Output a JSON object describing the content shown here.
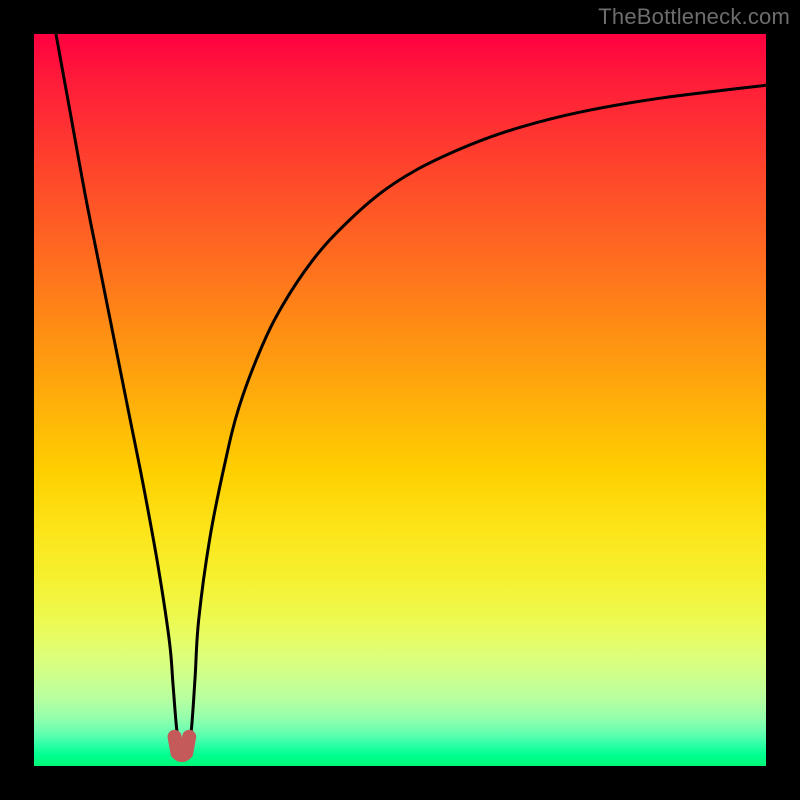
{
  "watermark": "TheBottleneck.com",
  "chart_data": {
    "type": "line",
    "title": "",
    "xlabel": "",
    "ylabel": "",
    "xlim": [
      0,
      100
    ],
    "ylim": [
      0,
      100
    ],
    "grid": false,
    "legend": false,
    "series": [
      {
        "name": "bottleneck-curve",
        "color": "#000000",
        "x": [
          3,
          5,
          7,
          9,
          11,
          13,
          15,
          17,
          18.5,
          19,
          19.5,
          20,
          20.5,
          21,
          21.5,
          22,
          22.5,
          24,
          26,
          28,
          31,
          34,
          38,
          42,
          47,
          52,
          58,
          64,
          71,
          78,
          86,
          94,
          100
        ],
        "y": [
          100,
          89,
          78,
          68,
          58,
          48,
          38,
          27,
          17,
          11,
          5,
          2.2,
          2,
          2.3,
          5,
          12,
          20,
          31,
          41,
          49,
          57,
          63,
          69,
          73.5,
          78,
          81.3,
          84.2,
          86.5,
          88.5,
          90,
          91.3,
          92.3,
          93
        ]
      },
      {
        "name": "minimum-marker",
        "color": "#c45a5a",
        "x": [
          19.2,
          19.6,
          20.0,
          20.4,
          20.8,
          21.2
        ],
        "y": [
          4.0,
          1.8,
          1.5,
          1.5,
          1.8,
          4.0
        ]
      }
    ],
    "annotations": []
  }
}
